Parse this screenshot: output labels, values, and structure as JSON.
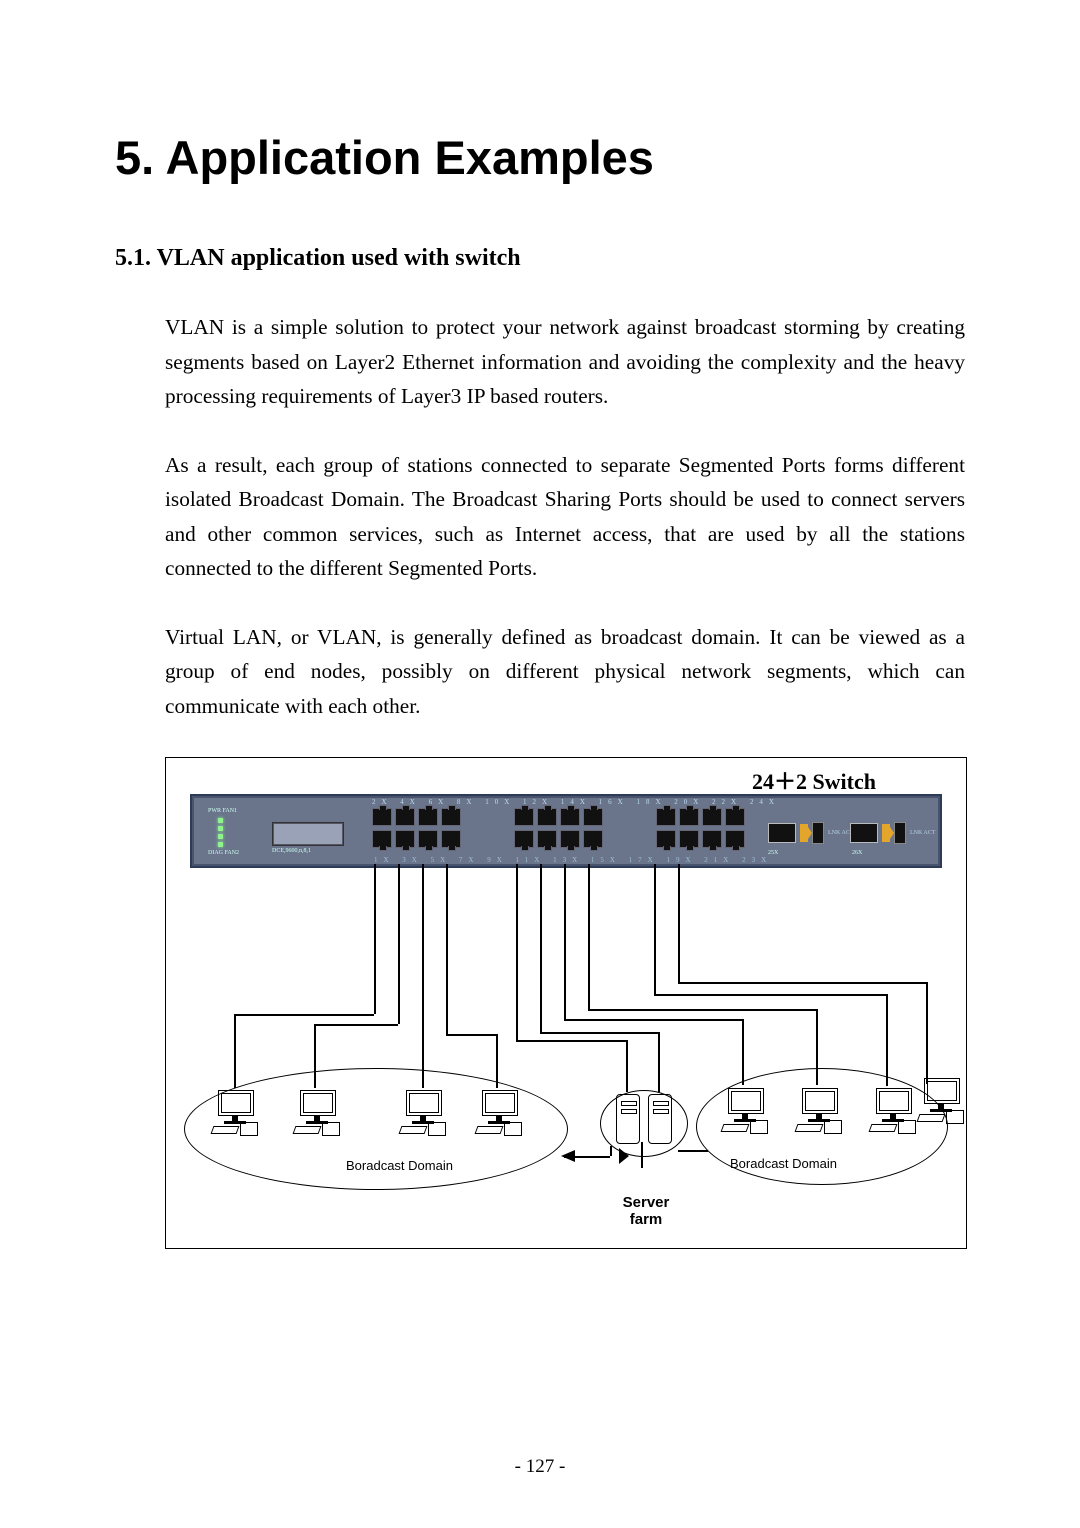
{
  "chapter_title": "5. Application Examples",
  "section_title": "5.1.  VLAN application used with switch",
  "para1": "VLAN is a simple solution to protect your network against broadcast storming by creating segments based on Layer2 Ethernet information and avoiding the complexity and the heavy processing requirements of Layer3 IP based routers.",
  "para2": "As a result, each group of stations connected to separate Segmented Ports forms different isolated Broadcast Domain. The Broadcast Sharing Ports should be used to connect servers and other common services, such as Internet access, that are used by all the stations connected to the different Segmented Ports.",
  "para3": "Virtual LAN, or VLAN, is generally defined as broadcast domain. It can be viewed as a group of end nodes, possibly on different physical network segments, which can communicate with each other.",
  "diagram": {
    "title": "24＋2 Switch",
    "top_port_labels": "2X  4X  6X  8X   10X  12X  14X  16X   18X  20X  22X  24X",
    "bottom_port_labels": "1X  3X  5X  7X   9X  11X  13X  15X   17X  19X  21X  23X",
    "pwr_label": "PWR FAN1",
    "diag_label": "DIAG FAN2",
    "dce_label": "DCE,9600,n,8,1",
    "sfp_label_1": "LNK\nACT",
    "sfp_label_2": "LNK\nACT",
    "sfp_num_1": "25X",
    "sfp_num_2": "26X",
    "domain_left": "Boradcast Domain",
    "domain_right": "Boradcast Domain",
    "server_label": "Server\nfarm"
  },
  "page_number": "- 127 -"
}
